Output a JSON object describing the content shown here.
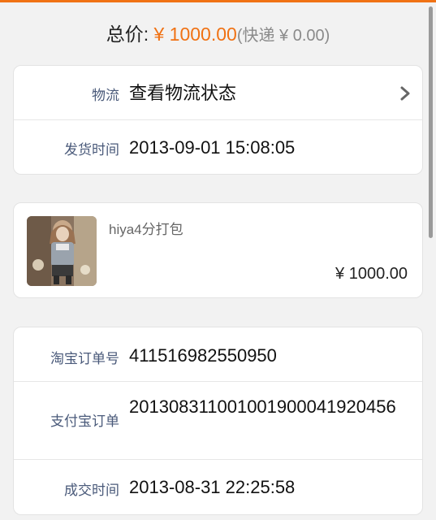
{
  "summary": {
    "total_label": "总价:",
    "total_amount": "¥ 1000.00",
    "shipping": "(快递 ¥ 0.00)"
  },
  "logistics": {
    "label": "物流",
    "value": "查看物流状态",
    "ship_time_label": "发货时间",
    "ship_time_value": "2013-09-01 15:08:05"
  },
  "item": {
    "name": "hiya4分打包",
    "price": "¥ 1000.00"
  },
  "order": {
    "taobao_label": "淘宝订单号",
    "taobao_value": "411516982550950",
    "alipay_label": "支付宝订单",
    "alipay_value": "201308311001001900041920456",
    "deal_time_label": "成交时间",
    "deal_time_value": "2013-08-31 22:25:58"
  },
  "colors": {
    "accent": "#f07214",
    "label": "#4a5a7a"
  },
  "icons": {
    "chevron": "chevron-right-icon",
    "thumbnail": "product-thumbnail"
  }
}
